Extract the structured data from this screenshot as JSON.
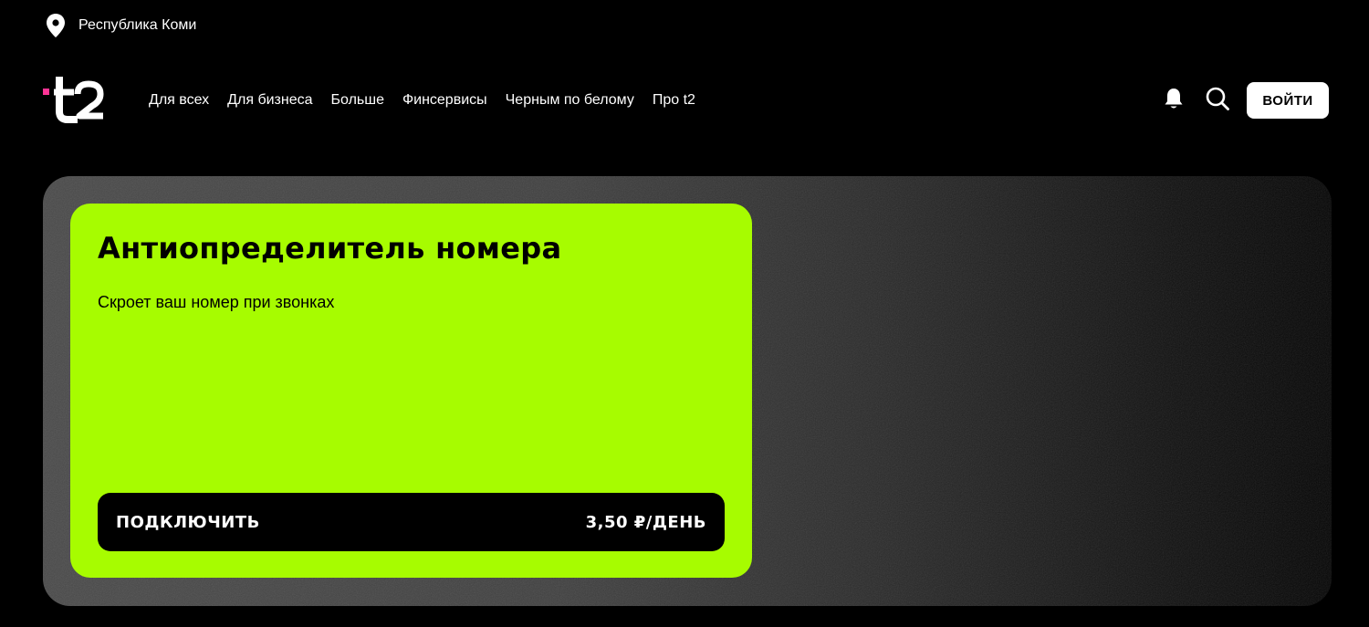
{
  "region": {
    "icon": "location-pin-icon",
    "label": "Республика Коми"
  },
  "header": {
    "logo_text": "t2",
    "logo_accent_color": "#ff3495",
    "nav": [
      {
        "label": "Для всех"
      },
      {
        "label": "Для бизнеса"
      },
      {
        "label": "Больше"
      },
      {
        "label": "Финсервисы"
      },
      {
        "label": "Черным по белому"
      },
      {
        "label": "Про t2"
      }
    ],
    "actions": {
      "notifications_icon": "bell-icon",
      "search_icon": "search-icon",
      "login_label": "ВОЙТИ"
    }
  },
  "hero": {
    "card_color": "#a7fc00",
    "title": "Антиопределитель номера",
    "subtitle": "Скроет ваш номер при звонках",
    "cta_label": "ПОДКЛЮЧИТЬ",
    "price": "3,50 ₽/ДЕНЬ"
  }
}
